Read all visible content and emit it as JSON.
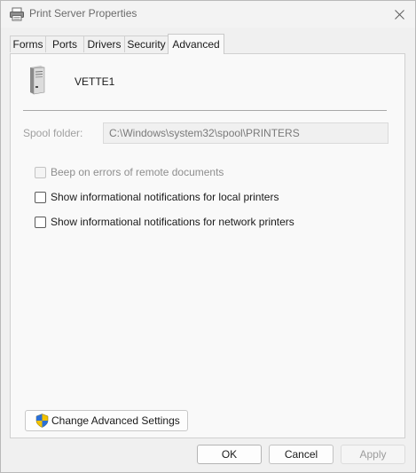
{
  "window": {
    "title": "Print Server Properties"
  },
  "tabs": [
    {
      "label": "Forms",
      "active": false
    },
    {
      "label": "Ports",
      "active": false
    },
    {
      "label": "Drivers",
      "active": false
    },
    {
      "label": "Security",
      "active": false
    },
    {
      "label": "Advanced",
      "active": true
    }
  ],
  "server": {
    "name": "VETTE1"
  },
  "spool": {
    "label": "Spool folder:",
    "value": "C:\\Windows\\system32\\spool\\PRINTERS"
  },
  "options": [
    {
      "label": "Beep on errors of remote documents",
      "checked": false,
      "disabled": true
    },
    {
      "label": "Show informational notifications for local printers",
      "checked": false,
      "disabled": false
    },
    {
      "label": "Show informational notifications for network printers",
      "checked": false,
      "disabled": false
    }
  ],
  "advanced_button": {
    "label": "Change Advanced Settings"
  },
  "buttons": {
    "ok": "OK",
    "cancel": "Cancel",
    "apply": "Apply"
  },
  "colors": {
    "shield_blue": "#2b6fd6",
    "shield_yellow": "#f2c200"
  },
  "icons": {
    "title": "printer-icon",
    "server": "server-tower-icon",
    "shield": "uac-shield-icon",
    "close": "close-icon"
  }
}
